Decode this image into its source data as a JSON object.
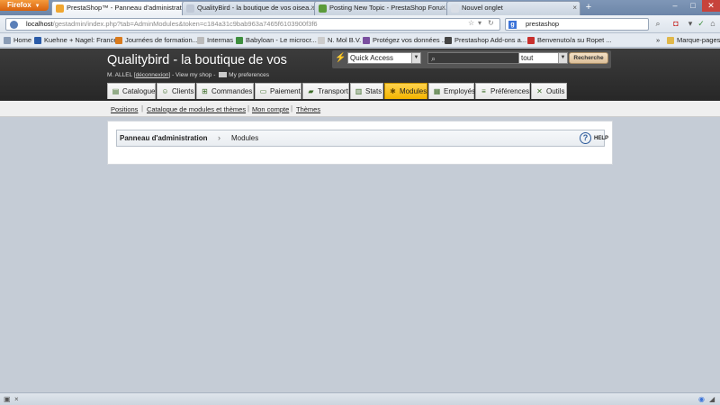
{
  "browser": {
    "firefox_label": "Firefox",
    "tabs": [
      {
        "title": "PrestaShop™ - Panneau d'administrat...",
        "favicon_color": "#f0a630"
      },
      {
        "title": "QualityBird - la boutique de vos oisea...",
        "favicon_color": "#bfc8d6"
      },
      {
        "title": "Posting New Topic - PrestaShop Foru...",
        "favicon_color": "#5b9b3a"
      },
      {
        "title": "Nouvel onglet",
        "favicon_color": "#d9dee6"
      }
    ],
    "new_tab_symbol": "+",
    "url_host": "localhost",
    "url_path": "/gestadmin/index.php?tab=AdminModules&token=c184a31c9bab963a7465f6103900f3f6",
    "search_value": "prestashop",
    "search_engine_letter": "g",
    "bookmarks": [
      {
        "label": "Home",
        "color": "#8a9cb5"
      },
      {
        "label": "Kuehne + Nagel: France",
        "color": "#2a5ba8"
      },
      {
        "label": "Journées de formation...",
        "color": "#d97b1e"
      },
      {
        "label": "Intermas",
        "color": "#bbbbbb"
      },
      {
        "label": "Babyloan - Le microcr...",
        "color": "#3f8f3f"
      },
      {
        "label": "N. Mol B.V.",
        "color": "#cccccc"
      },
      {
        "label": "Protégez vos données ...",
        "color": "#7a4fa0"
      },
      {
        "label": "Prestashop Add-ons a...",
        "color": "#444444"
      },
      {
        "label": "Benvenuto/a su Ropet ...",
        "color": "#c8302d"
      }
    ],
    "bookmarks_overflow": "»",
    "bookmarks_folder": "Marque-pages"
  },
  "ps": {
    "shop_title": "Qualitybird - la boutique de vos",
    "user_name": "M. ALLEL",
    "logout_label": "déconnexion",
    "view_shop_label": "View my shop",
    "preferences_label": "My preferences",
    "quick_access_label": "Quick Access",
    "search_scope": "tout",
    "search_button": "Recherche",
    "menu": [
      {
        "label": "Catalogue",
        "icon": "catalog-icon"
      },
      {
        "label": "Clients",
        "icon": "clients-icon"
      },
      {
        "label": "Commandes",
        "icon": "cart-icon"
      },
      {
        "label": "Paiement",
        "icon": "payment-icon"
      },
      {
        "label": "Transport",
        "icon": "truck-icon"
      },
      {
        "label": "Stats",
        "icon": "stats-icon"
      },
      {
        "label": "Modules",
        "icon": "modules-icon",
        "active": true
      },
      {
        "label": "Employés",
        "icon": "employees-icon"
      },
      {
        "label": "Préférences",
        "icon": "preferences-icon"
      },
      {
        "label": "Outils",
        "icon": "tools-icon"
      }
    ],
    "submenu": [
      "Positions",
      "Catalogue de modules et thèmes",
      "Mon compte",
      "Thèmes"
    ],
    "breadcrumb_root": "Panneau d'administration",
    "breadcrumb_page": "Modules",
    "help_label": "HELP",
    "active_color": "#f5c000"
  }
}
